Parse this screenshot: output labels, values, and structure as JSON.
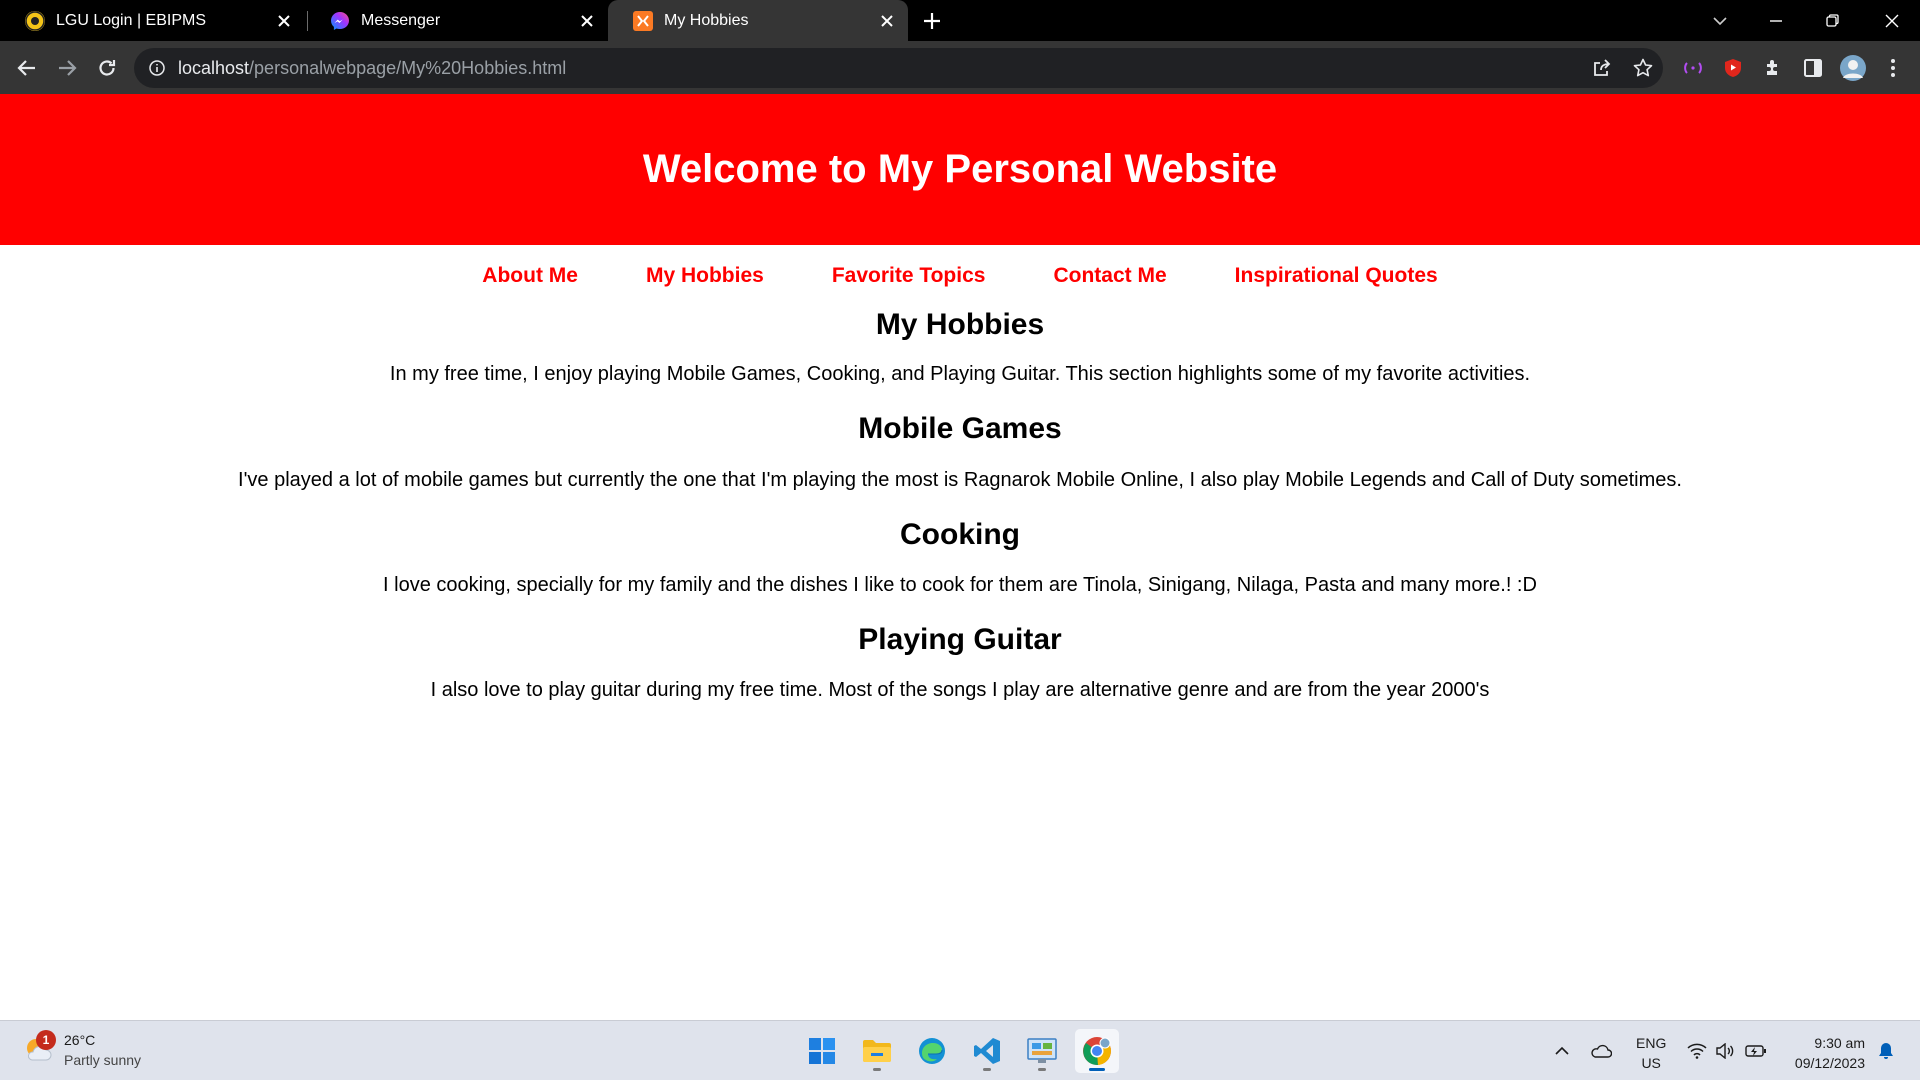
{
  "browser": {
    "tabs": [
      {
        "title": "LGU Login | EBIPMS",
        "favicon": "ebipms-logo-icon",
        "active": false
      },
      {
        "title": "Messenger",
        "favicon": "messenger-icon",
        "active": false
      },
      {
        "title": "My Hobbies",
        "favicon": "xampp-icon",
        "active": true
      }
    ],
    "url_host": "localhost",
    "url_path": "/personalwebpage/My%20Hobbies.html"
  },
  "site": {
    "header_title": "Welcome to My Personal Website",
    "nav": [
      "About Me",
      "My Hobbies",
      "Favorite Topics",
      "Contact Me",
      "Inspirational Quotes"
    ],
    "sections": [
      {
        "heading": "My Hobbies",
        "text": "In my free time, I enjoy playing Mobile Games, Cooking, and Playing Guitar. This section highlights some of my favorite activities."
      },
      {
        "heading": "Mobile Games",
        "text": "I've played a lot of mobile games but currently the one that I'm playing the most is Ragnarok Mobile Online, I also play Mobile Legends and Call of Duty sometimes."
      },
      {
        "heading": "Cooking",
        "text": "I love cooking, specially for my family and the dishes I like to cook for them are Tinola, Sinigang, Nilaga, Pasta and many more.! :D"
      },
      {
        "heading": "Playing Guitar",
        "text": "I also love to play guitar during my free time. Most of the songs I play are alternative genre and are from the year 2000's"
      }
    ]
  },
  "taskbar": {
    "weather": {
      "temp": "26°C",
      "condition": "Partly sunny",
      "badge": "1"
    },
    "apps": [
      "start-icon",
      "file-explorer-icon",
      "edge-icon",
      "vscode-icon",
      "control-panel-icon",
      "chrome-icon"
    ],
    "lang_top": "ENG",
    "lang_bottom": "US",
    "time": "9:30 am",
    "date": "09/12/2023"
  },
  "colors": {
    "header_red": "#ff0000",
    "nav_red": "#ff0000",
    "tabstrip": "#000000",
    "toolbar": "#353535",
    "taskbar": "#dfe3ec"
  }
}
